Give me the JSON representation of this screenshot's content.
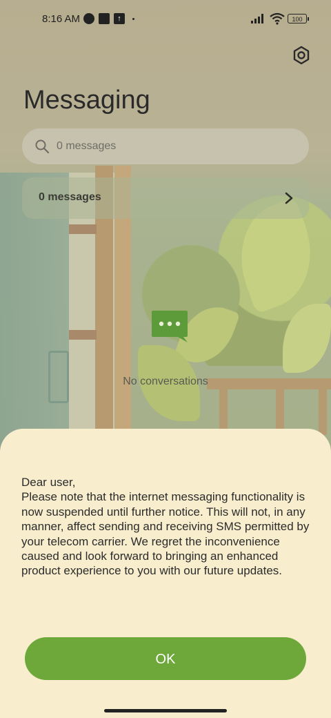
{
  "status_bar": {
    "time": "8:16 AM",
    "battery": "100"
  },
  "app": {
    "title": "Messaging",
    "settings_icon": "gear-hex-icon"
  },
  "search": {
    "placeholder": "0 messages"
  },
  "message_row": {
    "label": "0 messages"
  },
  "empty_state": {
    "text": "No conversations",
    "icon": "chat-bubble-icon"
  },
  "dialog": {
    "message": "Dear user,\nPlease note that the internet messaging functionality is now suspended until further notice. This will not, in any manner, affect sending and receiving SMS permitted by your telecom carrier. We regret the inconvenience caused and look forward to bringing an enhanced product experience to you with our future updates.",
    "ok_label": "OK"
  },
  "colors": {
    "accent": "#6ea83b",
    "sheet_bg": "#f8eece"
  }
}
